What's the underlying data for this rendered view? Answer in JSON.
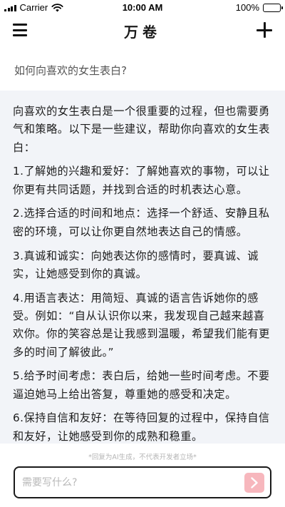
{
  "status_bar": {
    "carrier": "Carrier",
    "time": "10:00 AM",
    "battery": "100%",
    "battery_level": 1.0
  },
  "nav": {
    "title": "万卷",
    "menu_icon": "hamburger-menu-icon",
    "add_icon": "plus-icon"
  },
  "question": "如何向喜欢的女生表白?",
  "answer": {
    "paragraphs": [
      "向喜欢的女生表白是一个很重要的过程，但也需要勇气和策略。以下是一些建议，帮助你向喜欢的女生表白：",
      "1.了解她的兴趣和爱好：了解她喜欢的事物，可以让你更有共同话题，并找到合适的时机表达心意。",
      "2.选择合适的时间和地点：选择一个舒适、安静且私密的环境，可以让你更自然地表达自己的情感。",
      "3.真诚和诚实：向她表达你的感情时，要真诚、诚实，让她感受到你的真诚。",
      "4.用语言表达：用简短、真诚的语言告诉她你的感受。例如：“自从认识你以来，我发现自己越来越喜欢你。你的笑容总是让我感到温暖，希望我们能有更多的时间了解彼此。”",
      "5.给予时间考虑：表白后，给她一些时间考虑。不要逼迫她马上给出答复，尊重她的感受和决定。",
      "6.保持自信和友好：在等待回复的过程中，保持自信和友好，让她感受到你的成熟和稳重。"
    ]
  },
  "disclaimer": "*回复为AI生成，不代表开发者立场*",
  "input": {
    "placeholder": "需要写什么?",
    "value": "",
    "send_icon": "send-arrow-icon"
  },
  "colors": {
    "card_background": "#f2f4f8",
    "send_button": "#f7b7bd"
  }
}
